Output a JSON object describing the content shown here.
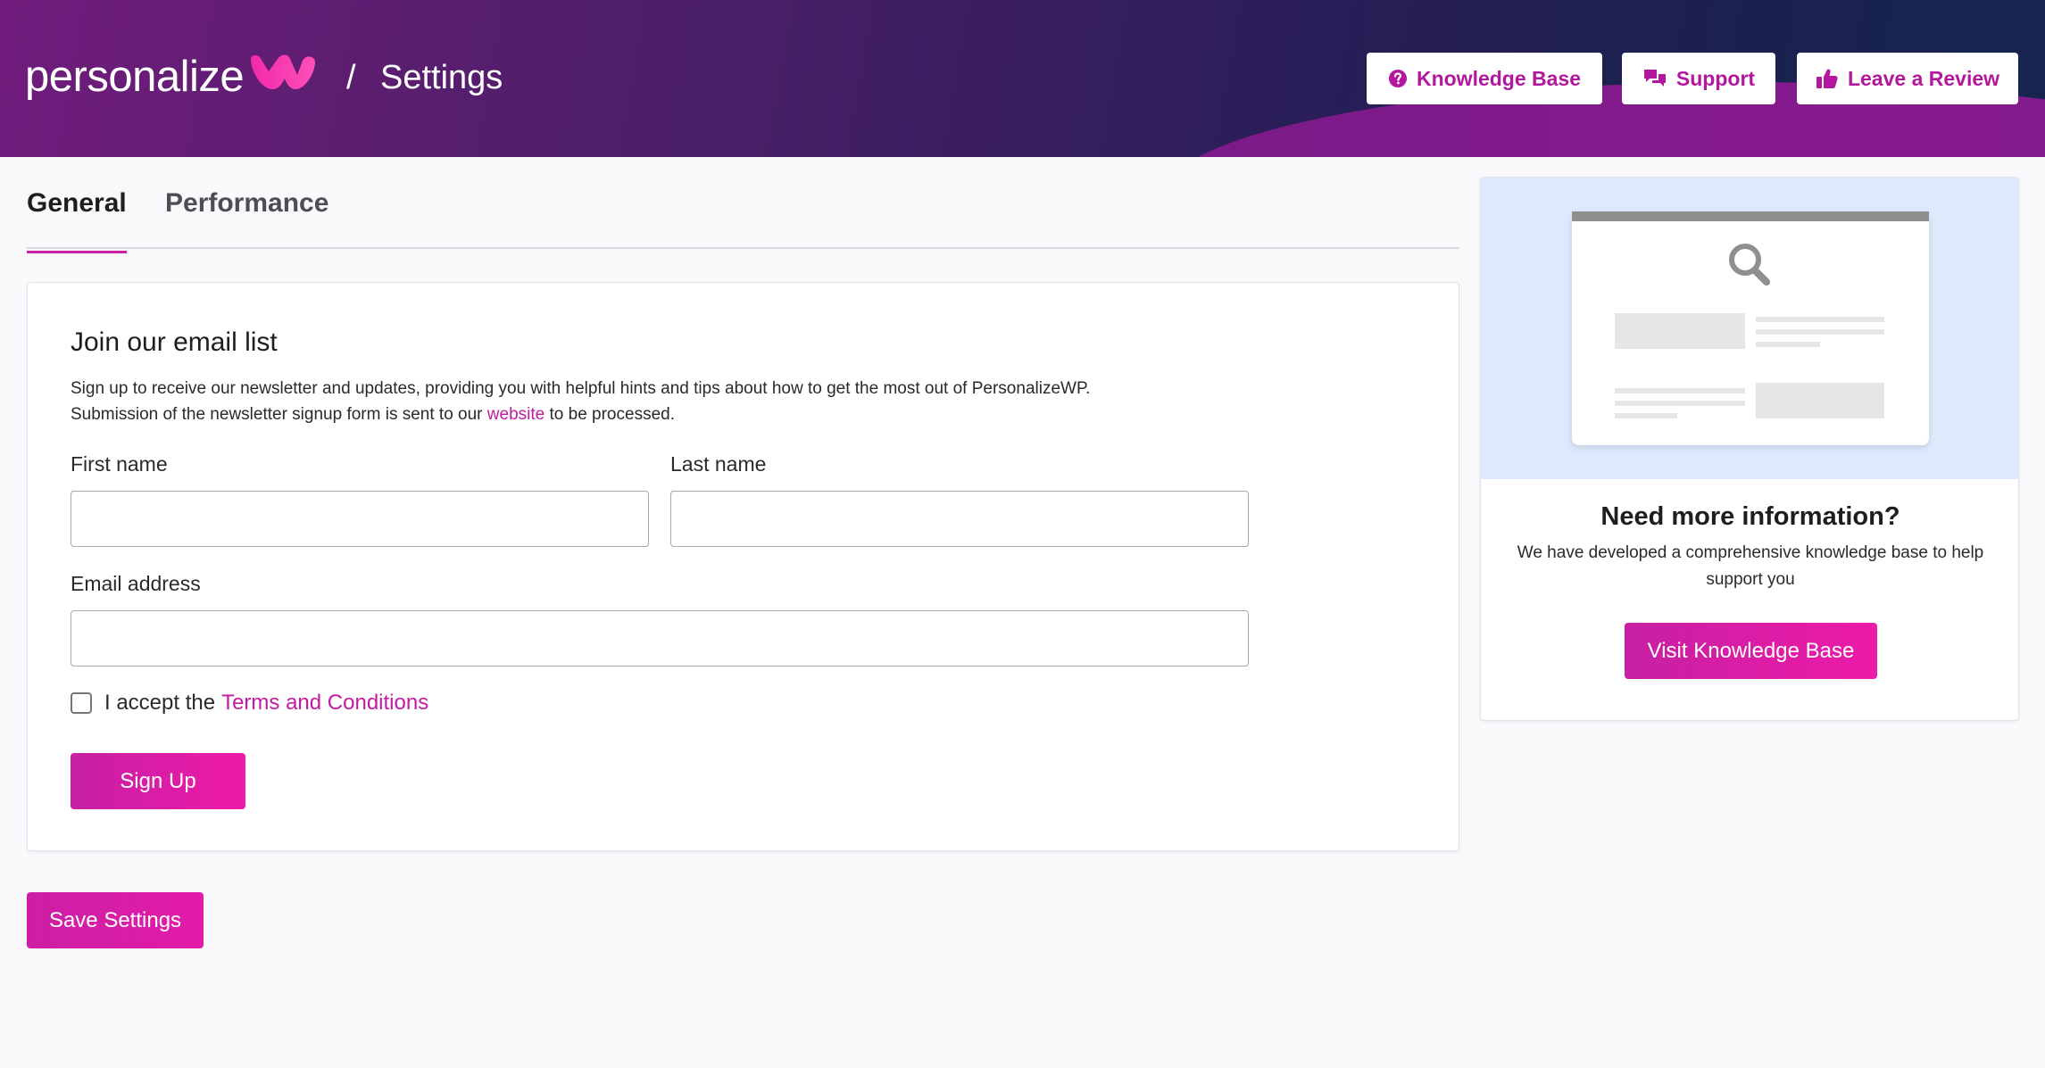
{
  "header": {
    "brand": "personalize",
    "separator": "/",
    "title": "Settings",
    "buttons": {
      "knowledge_base": "Knowledge Base",
      "support": "Support",
      "review": "Leave a Review"
    },
    "icons": {
      "knowledge_base": "question-circle-icon",
      "support": "chat-bubbles-icon",
      "review": "thumbs-up-icon"
    }
  },
  "tabs": [
    {
      "label": "General",
      "active": true
    },
    {
      "label": "Performance",
      "active": false
    }
  ],
  "signup": {
    "title": "Join our email list",
    "desc_line1": "Sign up to receive our newsletter and updates, providing you with helpful hints and tips about how to get the most out of PersonalizeWP.",
    "desc_line2_before": "Submission of the newsletter signup form is sent to our",
    "desc_link": "website",
    "desc_line2_after": "to be processed.",
    "first_name_label": "First name",
    "first_name_value": "",
    "last_name_label": "Last name",
    "last_name_value": "",
    "email_label": "Email address",
    "email_value": "",
    "terms_prefix": "I accept the",
    "terms_link": "Terms and Conditions",
    "terms_checked": false,
    "submit_label": "Sign Up"
  },
  "save_label": "Save Settings",
  "sidebar": {
    "title": "Need more information?",
    "description": "We have developed a comprehensive knowledge base to help support you",
    "button_label": "Visit Knowledge Base",
    "illustration": "browser-search-illustration"
  },
  "colors": {
    "accent": "#c81ea6",
    "accent_bright": "#ee1aa9",
    "header_dark": "#16254f",
    "header_purple": "#701c7c",
    "hero_bg": "#ddeafd"
  }
}
